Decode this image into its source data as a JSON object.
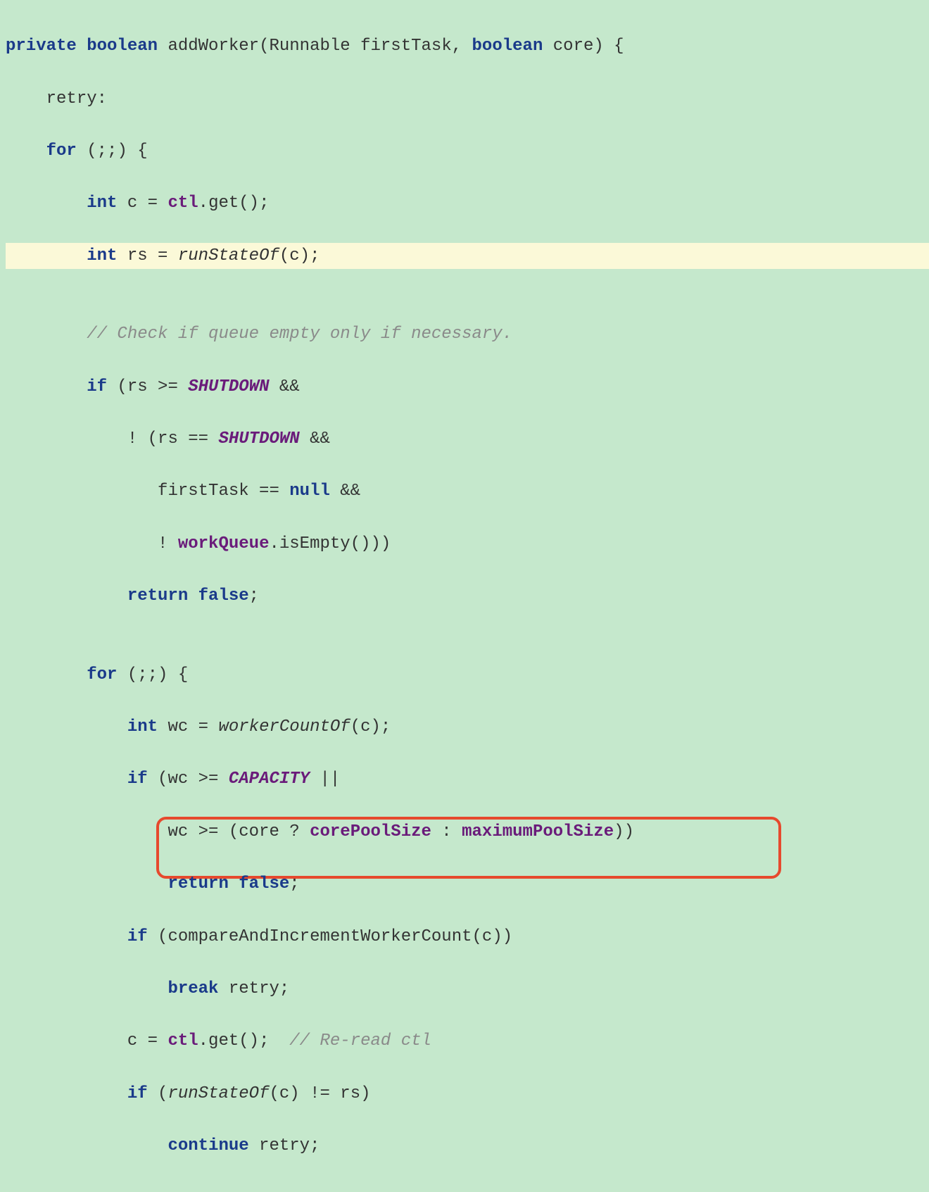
{
  "code": {
    "l1": {
      "a": "private boolean",
      "b": " addWorker(Runnable firstTask, ",
      "c": "boolean",
      "d": " core) {"
    },
    "l2": "    retry:",
    "l3": {
      "a": "    ",
      "b": "for",
      "c": " (;;) {"
    },
    "l4": {
      "a": "        ",
      "b": "int",
      "c": " c = ",
      "d": "ctl",
      "e": ".get();"
    },
    "l5": {
      "a": "        ",
      "b": "int",
      "c": " rs = ",
      "d": "runStateOf",
      "e": "(c);"
    },
    "l6": "",
    "l7": {
      "a": "        ",
      "b": "// Check if queue empty only if necessary."
    },
    "l8": {
      "a": "        ",
      "b": "if",
      "c": " (rs >= ",
      "d": "SHUTDOWN",
      "e": " &&"
    },
    "l9": {
      "a": "            ! (rs == ",
      "b": "SHUTDOWN",
      "c": " &&"
    },
    "l10": {
      "a": "               firstTask == ",
      "b": "null",
      "c": " &&"
    },
    "l11": {
      "a": "               ! ",
      "b": "workQueue",
      "c": ".isEmpty()))"
    },
    "l12": {
      "a": "            ",
      "b": "return false",
      "c": ";"
    },
    "l13": "",
    "l14": {
      "a": "        ",
      "b": "for",
      "c": " (;;) {"
    },
    "l15": {
      "a": "            ",
      "b": "int",
      "c": " wc = ",
      "d": "workerCountOf",
      "e": "(c);"
    },
    "l16": {
      "a": "            ",
      "b": "if",
      "c": " (wc >= ",
      "d": "CAPACITY",
      "e": " ||"
    },
    "l17": {
      "a": "                wc >= (core ? ",
      "b": "corePoolSize",
      "c": " : ",
      "d": "maximumPoolSize",
      "e": "))"
    },
    "l18": {
      "a": "                ",
      "b": "return false",
      "c": ";"
    },
    "l19": {
      "a": "            ",
      "b": "if",
      "c": " (compareAndIncrementWorkerCount(c))"
    },
    "l20": {
      "a": "                ",
      "b": "break",
      "c": " retry;"
    },
    "l21": {
      "a": "            c = ",
      "b": "ctl",
      "c": ".get();  ",
      "d": "// Re-read ctl"
    },
    "l22": {
      "a": "            ",
      "b": "if",
      "c": " (",
      "d": "runStateOf",
      "e": "(c) != rs)"
    },
    "l23": {
      "a": "                ",
      "b": "continue",
      "c": " retry;"
    }
  }
}
